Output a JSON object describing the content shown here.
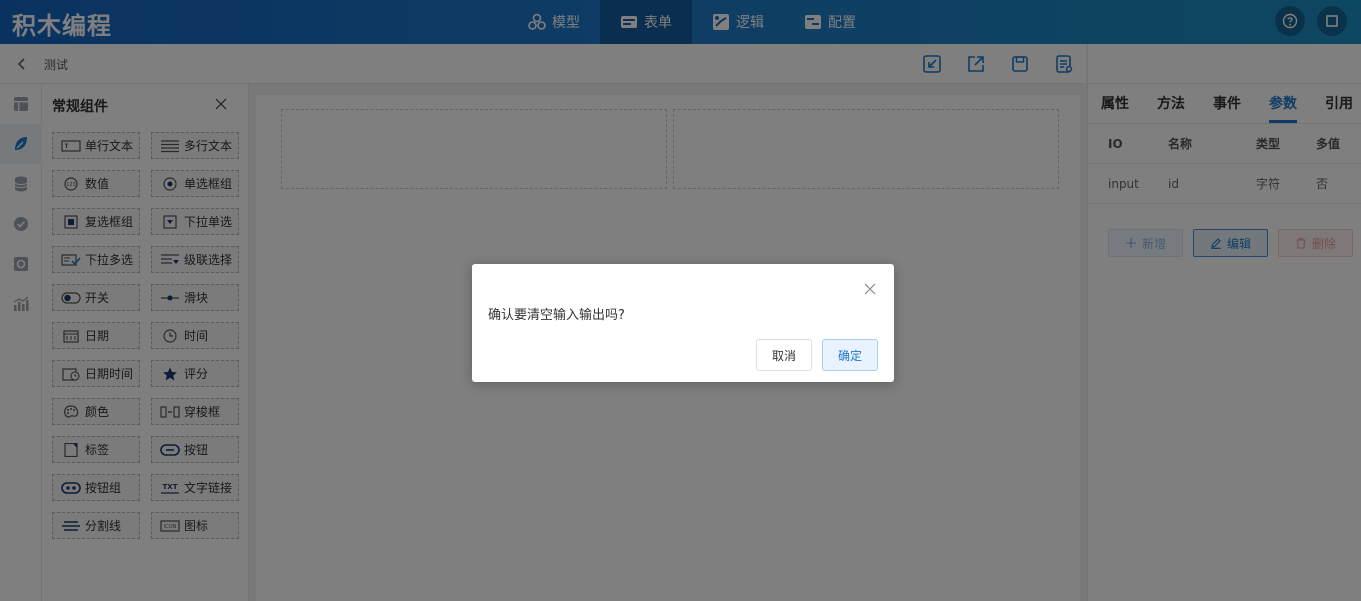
{
  "app": {
    "title": "积木编程"
  },
  "nav": {
    "items": [
      {
        "label": "模型",
        "icon": "model-icon",
        "active": false
      },
      {
        "label": "表单",
        "icon": "form-icon",
        "active": true
      },
      {
        "label": "逻辑",
        "icon": "logic-icon",
        "active": false
      },
      {
        "label": "配置",
        "icon": "config-icon",
        "active": false
      }
    ]
  },
  "breadcrumb": {
    "current": "测试"
  },
  "component_panel": {
    "title": "常规组件",
    "items": [
      {
        "label": "单行文本",
        "icon": "single-text-icon"
      },
      {
        "label": "多行文本",
        "icon": "multi-text-icon"
      },
      {
        "label": "数值",
        "icon": "number-icon"
      },
      {
        "label": "单选框组",
        "icon": "radio-icon"
      },
      {
        "label": "复选框组",
        "icon": "checkbox-icon"
      },
      {
        "label": "下拉单选",
        "icon": "select-icon"
      },
      {
        "label": "下拉多选",
        "icon": "multi-select-icon"
      },
      {
        "label": "级联选择",
        "icon": "cascader-icon"
      },
      {
        "label": "开关",
        "icon": "switch-icon"
      },
      {
        "label": "滑块",
        "icon": "slider-icon"
      },
      {
        "label": "日期",
        "icon": "date-icon"
      },
      {
        "label": "时间",
        "icon": "time-icon"
      },
      {
        "label": "日期时间",
        "icon": "datetime-icon"
      },
      {
        "label": "评分",
        "icon": "rate-icon"
      },
      {
        "label": "颜色",
        "icon": "color-icon"
      },
      {
        "label": "穿梭框",
        "icon": "transfer-icon"
      },
      {
        "label": "标签",
        "icon": "tag-icon"
      },
      {
        "label": "按钮",
        "icon": "button-icon"
      },
      {
        "label": "按钮组",
        "icon": "button-group-icon"
      },
      {
        "label": "文字链接",
        "icon": "text-link-icon"
      },
      {
        "label": "分割线",
        "icon": "divider-icon"
      },
      {
        "label": "图标",
        "icon": "icon-component-icon"
      }
    ]
  },
  "right_panel": {
    "tabs": [
      {
        "label": "属性",
        "active": false
      },
      {
        "label": "方法",
        "active": false
      },
      {
        "label": "事件",
        "active": false
      },
      {
        "label": "参数",
        "active": true
      },
      {
        "label": "引用",
        "active": false
      }
    ],
    "table": {
      "columns": [
        "IO",
        "名称",
        "类型",
        "多值"
      ],
      "rows": [
        [
          "input",
          "id",
          "字符",
          "否"
        ]
      ]
    },
    "buttons": {
      "add": "新增",
      "edit": "编辑",
      "delete": "删除"
    }
  },
  "dialog": {
    "message": "确认要清空输入输出吗?",
    "cancel": "取消",
    "confirm": "确定"
  },
  "colors": {
    "accent": "#1e78c8",
    "danger": "#f56c6c"
  }
}
